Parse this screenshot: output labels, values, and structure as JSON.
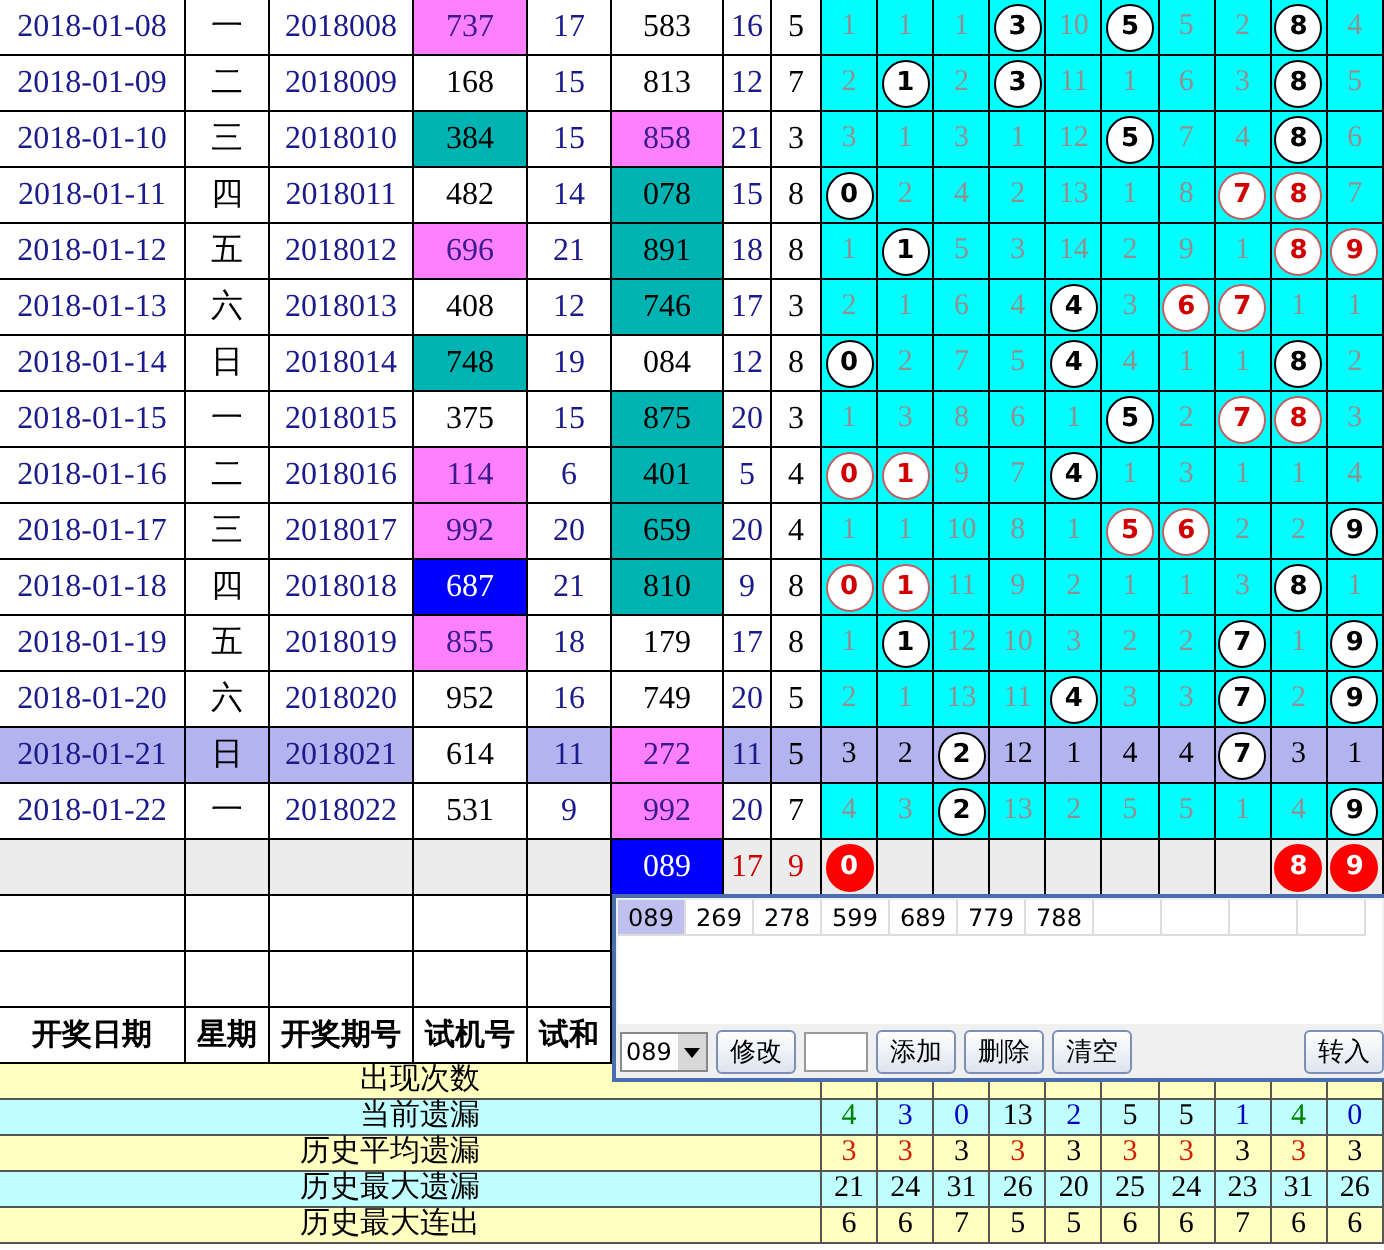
{
  "rows": [
    {
      "date": "2018-01-08",
      "weekday": "一",
      "issue": "2018008",
      "trial": {
        "text": "737",
        "color": "#ff80ff"
      },
      "trial_sum": "17",
      "number": {
        "text": "583"
      },
      "sum": "16",
      "span": "5",
      "selected": false,
      "digits": [
        {
          "text": "1",
          "kind": "miss"
        },
        {
          "text": "1",
          "kind": "miss"
        },
        {
          "text": "1",
          "kind": "miss"
        },
        {
          "text": "3",
          "kind": "hit"
        },
        {
          "text": "10",
          "kind": "miss"
        },
        {
          "text": "5",
          "kind": "hit"
        },
        {
          "text": "5",
          "kind": "miss"
        },
        {
          "text": "2",
          "kind": "miss"
        },
        {
          "text": "8",
          "kind": "hit"
        },
        {
          "text": "4",
          "kind": "miss"
        }
      ]
    },
    {
      "date": "2018-01-09",
      "weekday": "二",
      "issue": "2018009",
      "trial": {
        "text": "168"
      },
      "trial_sum": "15",
      "number": {
        "text": "813"
      },
      "sum": "12",
      "span": "7",
      "selected": false,
      "digits": [
        {
          "text": "2",
          "kind": "miss"
        },
        {
          "text": "1",
          "kind": "hit"
        },
        {
          "text": "2",
          "kind": "miss"
        },
        {
          "text": "3",
          "kind": "hit"
        },
        {
          "text": "11",
          "kind": "miss"
        },
        {
          "text": "1",
          "kind": "miss"
        },
        {
          "text": "6",
          "kind": "miss"
        },
        {
          "text": "3",
          "kind": "miss"
        },
        {
          "text": "8",
          "kind": "hit"
        },
        {
          "text": "5",
          "kind": "miss"
        }
      ]
    },
    {
      "date": "2018-01-10",
      "weekday": "三",
      "issue": "2018010",
      "trial": {
        "text": "384",
        "color": "#00b3b3"
      },
      "trial_sum": "15",
      "number": {
        "text": "858",
        "color": "#ff80ff"
      },
      "sum": "21",
      "span": "3",
      "selected": false,
      "digits": [
        {
          "text": "3",
          "kind": "miss"
        },
        {
          "text": "1",
          "kind": "miss"
        },
        {
          "text": "3",
          "kind": "miss"
        },
        {
          "text": "1",
          "kind": "miss"
        },
        {
          "text": "12",
          "kind": "miss"
        },
        {
          "text": "5",
          "kind": "hit"
        },
        {
          "text": "7",
          "kind": "miss"
        },
        {
          "text": "4",
          "kind": "miss"
        },
        {
          "text": "8",
          "kind": "hit"
        },
        {
          "text": "6",
          "kind": "miss"
        }
      ]
    },
    {
      "date": "2018-01-11",
      "weekday": "四",
      "issue": "2018011",
      "trial": {
        "text": "482"
      },
      "trial_sum": "14",
      "number": {
        "text": "078",
        "color": "#00b3b3"
      },
      "sum": "15",
      "span": "8",
      "selected": false,
      "digits": [
        {
          "text": "0",
          "kind": "hit"
        },
        {
          "text": "2",
          "kind": "miss"
        },
        {
          "text": "4",
          "kind": "miss"
        },
        {
          "text": "2",
          "kind": "miss"
        },
        {
          "text": "13",
          "kind": "miss"
        },
        {
          "text": "1",
          "kind": "miss"
        },
        {
          "text": "8",
          "kind": "miss"
        },
        {
          "text": "7",
          "kind": "redhit"
        },
        {
          "text": "8",
          "kind": "redhit"
        },
        {
          "text": "7",
          "kind": "miss"
        }
      ]
    },
    {
      "date": "2018-01-12",
      "weekday": "五",
      "issue": "2018012",
      "trial": {
        "text": "696",
        "color": "#ff80ff"
      },
      "trial_sum": "21",
      "number": {
        "text": "891",
        "color": "#00b3b3"
      },
      "sum": "18",
      "span": "8",
      "selected": false,
      "digits": [
        {
          "text": "1",
          "kind": "miss"
        },
        {
          "text": "1",
          "kind": "hit"
        },
        {
          "text": "5",
          "kind": "miss"
        },
        {
          "text": "3",
          "kind": "miss"
        },
        {
          "text": "14",
          "kind": "miss"
        },
        {
          "text": "2",
          "kind": "miss"
        },
        {
          "text": "9",
          "kind": "miss"
        },
        {
          "text": "1",
          "kind": "miss"
        },
        {
          "text": "8",
          "kind": "redhit"
        },
        {
          "text": "9",
          "kind": "redhit"
        }
      ]
    },
    {
      "date": "2018-01-13",
      "weekday": "六",
      "issue": "2018013",
      "trial": {
        "text": "408"
      },
      "trial_sum": "12",
      "number": {
        "text": "746",
        "color": "#00b3b3"
      },
      "sum": "17",
      "span": "3",
      "selected": false,
      "digits": [
        {
          "text": "2",
          "kind": "miss"
        },
        {
          "text": "1",
          "kind": "miss"
        },
        {
          "text": "6",
          "kind": "miss"
        },
        {
          "text": "4",
          "kind": "miss"
        },
        {
          "text": "4",
          "kind": "hit"
        },
        {
          "text": "3",
          "kind": "miss"
        },
        {
          "text": "6",
          "kind": "redhit"
        },
        {
          "text": "7",
          "kind": "redhit"
        },
        {
          "text": "1",
          "kind": "miss"
        },
        {
          "text": "1",
          "kind": "miss"
        }
      ]
    },
    {
      "date": "2018-01-14",
      "weekday": "日",
      "issue": "2018014",
      "trial": {
        "text": "748",
        "color": "#00b3b3"
      },
      "trial_sum": "19",
      "number": {
        "text": "084"
      },
      "sum": "12",
      "span": "8",
      "selected": false,
      "digits": [
        {
          "text": "0",
          "kind": "hit"
        },
        {
          "text": "2",
          "kind": "miss"
        },
        {
          "text": "7",
          "kind": "miss"
        },
        {
          "text": "5",
          "kind": "miss"
        },
        {
          "text": "4",
          "kind": "hit"
        },
        {
          "text": "4",
          "kind": "miss"
        },
        {
          "text": "1",
          "kind": "miss"
        },
        {
          "text": "1",
          "kind": "miss"
        },
        {
          "text": "8",
          "kind": "hit"
        },
        {
          "text": "2",
          "kind": "miss"
        }
      ]
    },
    {
      "date": "2018-01-15",
      "weekday": "一",
      "issue": "2018015",
      "trial": {
        "text": "375"
      },
      "trial_sum": "15",
      "number": {
        "text": "875",
        "color": "#00b3b3"
      },
      "sum": "20",
      "span": "3",
      "selected": false,
      "digits": [
        {
          "text": "1",
          "kind": "miss"
        },
        {
          "text": "3",
          "kind": "miss"
        },
        {
          "text": "8",
          "kind": "miss"
        },
        {
          "text": "6",
          "kind": "miss"
        },
        {
          "text": "1",
          "kind": "miss"
        },
        {
          "text": "5",
          "kind": "hit"
        },
        {
          "text": "2",
          "kind": "miss"
        },
        {
          "text": "7",
          "kind": "redhit"
        },
        {
          "text": "8",
          "kind": "redhit"
        },
        {
          "text": "3",
          "kind": "miss"
        }
      ]
    },
    {
      "date": "2018-01-16",
      "weekday": "二",
      "issue": "2018016",
      "trial": {
        "text": "114",
        "color": "#ff80ff"
      },
      "trial_sum": "6",
      "number": {
        "text": "401",
        "color": "#00b3b3"
      },
      "sum": "5",
      "span": "4",
      "selected": false,
      "digits": [
        {
          "text": "0",
          "kind": "redhit"
        },
        {
          "text": "1",
          "kind": "redhit"
        },
        {
          "text": "9",
          "kind": "miss"
        },
        {
          "text": "7",
          "kind": "miss"
        },
        {
          "text": "4",
          "kind": "hit"
        },
        {
          "text": "1",
          "kind": "miss"
        },
        {
          "text": "3",
          "kind": "miss"
        },
        {
          "text": "1",
          "kind": "miss"
        },
        {
          "text": "1",
          "kind": "miss"
        },
        {
          "text": "4",
          "kind": "miss"
        }
      ]
    },
    {
      "date": "2018-01-17",
      "weekday": "三",
      "issue": "2018017",
      "trial": {
        "text": "992",
        "color": "#ff80ff"
      },
      "trial_sum": "20",
      "number": {
        "text": "659",
        "color": "#00b3b3"
      },
      "sum": "20",
      "span": "4",
      "selected": false,
      "digits": [
        {
          "text": "1",
          "kind": "miss"
        },
        {
          "text": "1",
          "kind": "miss"
        },
        {
          "text": "10",
          "kind": "miss"
        },
        {
          "text": "8",
          "kind": "miss"
        },
        {
          "text": "1",
          "kind": "miss"
        },
        {
          "text": "5",
          "kind": "redhit"
        },
        {
          "text": "6",
          "kind": "redhit"
        },
        {
          "text": "2",
          "kind": "miss"
        },
        {
          "text": "2",
          "kind": "miss"
        },
        {
          "text": "9",
          "kind": "hit"
        }
      ]
    },
    {
      "date": "2018-01-18",
      "weekday": "四",
      "issue": "2018018",
      "trial": {
        "text": "687",
        "color": "#0000ff"
      },
      "trial_sum": "21",
      "number": {
        "text": "810",
        "color": "#00b3b3"
      },
      "sum": "9",
      "span": "8",
      "selected": false,
      "digits": [
        {
          "text": "0",
          "kind": "redhit"
        },
        {
          "text": "1",
          "kind": "redhit"
        },
        {
          "text": "11",
          "kind": "miss"
        },
        {
          "text": "9",
          "kind": "miss"
        },
        {
          "text": "2",
          "kind": "miss"
        },
        {
          "text": "1",
          "kind": "miss"
        },
        {
          "text": "1",
          "kind": "miss"
        },
        {
          "text": "3",
          "kind": "miss"
        },
        {
          "text": "8",
          "kind": "hit"
        },
        {
          "text": "1",
          "kind": "miss"
        }
      ]
    },
    {
      "date": "2018-01-19",
      "weekday": "五",
      "issue": "2018019",
      "trial": {
        "text": "855",
        "color": "#ff80ff"
      },
      "trial_sum": "18",
      "number": {
        "text": "179"
      },
      "sum": "17",
      "span": "8",
      "selected": false,
      "digits": [
        {
          "text": "1",
          "kind": "miss"
        },
        {
          "text": "1",
          "kind": "hit"
        },
        {
          "text": "12",
          "kind": "miss"
        },
        {
          "text": "10",
          "kind": "miss"
        },
        {
          "text": "3",
          "kind": "miss"
        },
        {
          "text": "2",
          "kind": "miss"
        },
        {
          "text": "2",
          "kind": "miss"
        },
        {
          "text": "7",
          "kind": "hit"
        },
        {
          "text": "1",
          "kind": "miss"
        },
        {
          "text": "9",
          "kind": "hit"
        }
      ]
    },
    {
      "date": "2018-01-20",
      "weekday": "六",
      "issue": "2018020",
      "trial": {
        "text": "952"
      },
      "trial_sum": "16",
      "number": {
        "text": "749"
      },
      "sum": "20",
      "span": "5",
      "selected": false,
      "digits": [
        {
          "text": "2",
          "kind": "miss"
        },
        {
          "text": "1",
          "kind": "miss"
        },
        {
          "text": "13",
          "kind": "miss"
        },
        {
          "text": "11",
          "kind": "miss"
        },
        {
          "text": "4",
          "kind": "hit"
        },
        {
          "text": "3",
          "kind": "miss"
        },
        {
          "text": "3",
          "kind": "miss"
        },
        {
          "text": "7",
          "kind": "hit"
        },
        {
          "text": "2",
          "kind": "miss"
        },
        {
          "text": "9",
          "kind": "hit"
        }
      ]
    },
    {
      "date": "2018-01-21",
      "weekday": "日",
      "issue": "2018021",
      "trial": {
        "text": "614",
        "color": "#ffffff"
      },
      "trial_sum": "11",
      "number": {
        "text": "272",
        "color": "#ff80ff"
      },
      "sum": "11",
      "span": "5",
      "selected": true,
      "digits": [
        {
          "text": "3",
          "kind": "miss"
        },
        {
          "text": "2",
          "kind": "miss"
        },
        {
          "text": "2",
          "kind": "hit"
        },
        {
          "text": "12",
          "kind": "miss"
        },
        {
          "text": "1",
          "kind": "miss"
        },
        {
          "text": "4",
          "kind": "miss"
        },
        {
          "text": "4",
          "kind": "miss"
        },
        {
          "text": "7",
          "kind": "hit"
        },
        {
          "text": "3",
          "kind": "miss"
        },
        {
          "text": "1",
          "kind": "miss"
        }
      ]
    },
    {
      "date": "2018-01-22",
      "weekday": "一",
      "issue": "2018022",
      "trial": {
        "text": "531"
      },
      "trial_sum": "9",
      "number": {
        "text": "992",
        "color": "#ff80ff"
      },
      "sum": "20",
      "span": "7",
      "selected": false,
      "digits": [
        {
          "text": "4",
          "kind": "miss"
        },
        {
          "text": "3",
          "kind": "miss"
        },
        {
          "text": "2",
          "kind": "hit"
        },
        {
          "text": "13",
          "kind": "miss"
        },
        {
          "text": "2",
          "kind": "miss"
        },
        {
          "text": "5",
          "kind": "miss"
        },
        {
          "text": "5",
          "kind": "miss"
        },
        {
          "text": "1",
          "kind": "miss"
        },
        {
          "text": "4",
          "kind": "miss"
        },
        {
          "text": "9",
          "kind": "hit"
        }
      ]
    }
  ],
  "prediction": {
    "number": {
      "text": "089",
      "color": "#0000ff"
    },
    "sum": "17",
    "span": "9",
    "digits": [
      {
        "text": "0",
        "kind": "pick"
      },
      {
        "kind": "empty"
      },
      {
        "kind": "empty"
      },
      {
        "kind": "empty"
      },
      {
        "kind": "empty"
      },
      {
        "kind": "empty"
      },
      {
        "kind": "empty"
      },
      {
        "kind": "empty"
      },
      {
        "text": "8",
        "kind": "pick"
      },
      {
        "text": "9",
        "kind": "pick"
      }
    ]
  },
  "header": [
    "开奖日期",
    "星期",
    "开奖期号",
    "试机号",
    "试和"
  ],
  "stats": [
    {
      "label": "出现次数"
    },
    {
      "label": "当前遗漏",
      "values": [
        {
          "text": "4",
          "color": "#008000"
        },
        {
          "text": "3",
          "color": "#0000c0"
        },
        {
          "text": "0",
          "color": "#0000c0"
        },
        {
          "text": "13",
          "color": "#000000"
        },
        {
          "text": "2",
          "color": "#0000c0"
        },
        {
          "text": "5",
          "color": "#000000"
        },
        {
          "text": "5",
          "color": "#000000"
        },
        {
          "text": "1",
          "color": "#0000c0"
        },
        {
          "text": "4",
          "color": "#008000"
        },
        {
          "text": "0",
          "color": "#0000c0"
        }
      ]
    },
    {
      "label": "历史平均遗漏",
      "values": [
        {
          "text": "3",
          "color": "#d02000"
        },
        {
          "text": "3",
          "color": "#d02000"
        },
        {
          "text": "3",
          "color": "#000000"
        },
        {
          "text": "3",
          "color": "#d02000"
        },
        {
          "text": "3",
          "color": "#000000"
        },
        {
          "text": "3",
          "color": "#d02000"
        },
        {
          "text": "3",
          "color": "#d02000"
        },
        {
          "text": "3",
          "color": "#000000"
        },
        {
          "text": "3",
          "color": "#d02000"
        },
        {
          "text": "3",
          "color": "#000000"
        }
      ]
    },
    {
      "label": "历史最大遗漏",
      "values": [
        {
          "text": "21"
        },
        {
          "text": "24"
        },
        {
          "text": "31"
        },
        {
          "text": "26"
        },
        {
          "text": "20"
        },
        {
          "text": "25"
        },
        {
          "text": "24"
        },
        {
          "text": "23"
        },
        {
          "text": "31"
        },
        {
          "text": "26"
        }
      ]
    },
    {
      "label": "历史最大连出",
      "values": [
        {
          "text": "6"
        },
        {
          "text": "6"
        },
        {
          "text": "7"
        },
        {
          "text": "5"
        },
        {
          "text": "5"
        },
        {
          "text": "6"
        },
        {
          "text": "6"
        },
        {
          "text": "7"
        },
        {
          "text": "6"
        },
        {
          "text": "6"
        }
      ]
    }
  ],
  "dialog": {
    "list": [
      {
        "text": "089",
        "selected": true
      },
      {
        "text": "269",
        "selected": false
      },
      {
        "text": "278",
        "selected": false
      },
      {
        "text": "599",
        "selected": false
      },
      {
        "text": "689",
        "selected": false
      },
      {
        "text": "779",
        "selected": false
      },
      {
        "text": "788",
        "selected": false
      }
    ],
    "toolbar": [
      {
        "kind": "combo",
        "value": "089"
      },
      {
        "kind": "button",
        "label": "修改"
      },
      {
        "kind": "input"
      },
      {
        "kind": "button",
        "label": "添加"
      },
      {
        "kind": "button",
        "label": "删除"
      },
      {
        "kind": "button",
        "label": "清空"
      },
      {
        "kind": "button",
        "label": "转入"
      }
    ]
  }
}
